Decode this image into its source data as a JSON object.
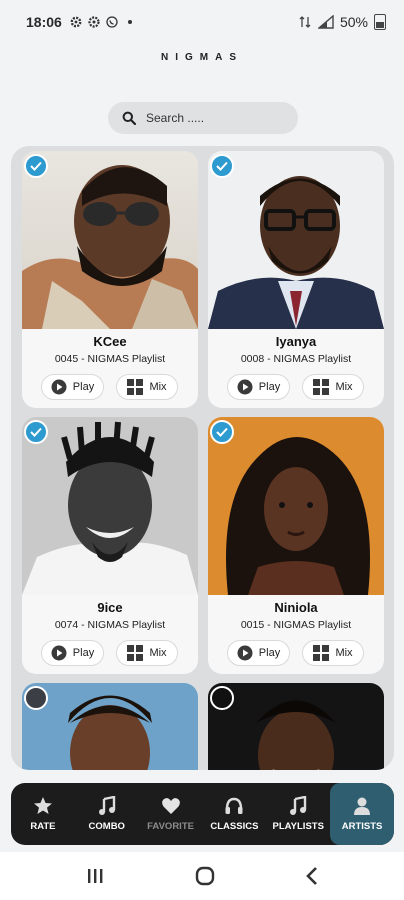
{
  "status_bar": {
    "time": "18:06",
    "battery": "50%"
  },
  "app": {
    "title": "NIGMAS"
  },
  "search": {
    "placeholder": "Search ....."
  },
  "artists": [
    {
      "name": "KCee",
      "subtitle": "0045 - NIGMAS Playlist",
      "play_label": "Play",
      "mix_label": "Mix",
      "selected": true
    },
    {
      "name": "Iyanya",
      "subtitle": "0008 - NIGMAS Playlist",
      "play_label": "Play",
      "mix_label": "Mix",
      "selected": true
    },
    {
      "name": "9ice",
      "subtitle": "0074 - NIGMAS Playlist",
      "play_label": "Play",
      "mix_label": "Mix",
      "selected": true
    },
    {
      "name": "Niniola",
      "subtitle": "0015 - NIGMAS Playlist",
      "play_label": "Play",
      "mix_label": "Mix",
      "selected": true
    }
  ],
  "nav": {
    "items": [
      {
        "label": "RATE",
        "icon": "star-icon"
      },
      {
        "label": "COMBO",
        "icon": "music-note-icon"
      },
      {
        "label": "FAVORITE",
        "icon": "heart-icon"
      },
      {
        "label": "CLASSICS",
        "icon": "headphones-icon"
      },
      {
        "label": "PLAYLISTS",
        "icon": "music-note-icon"
      },
      {
        "label": "ARTISTS",
        "icon": "person-icon"
      }
    ],
    "active": "ARTISTS"
  },
  "colors": {
    "accent": "#2d9ad0",
    "nav_bg": "#1c1c1c",
    "nav_active": "#2f5e70"
  }
}
